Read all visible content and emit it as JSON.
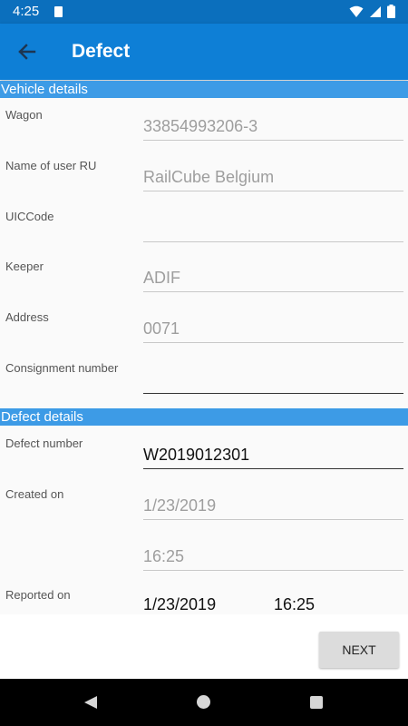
{
  "status": {
    "time": "4:25"
  },
  "appbar": {
    "title": "Defect"
  },
  "vehicle": {
    "header": "Vehicle details",
    "wagon": {
      "label": "Wagon",
      "value": "33854993206-3"
    },
    "user_ru": {
      "label": "Name of user RU",
      "value": "RailCube Belgium"
    },
    "uic": {
      "label": "UICCode",
      "value": ""
    },
    "keeper": {
      "label": "Keeper",
      "value": "ADIF"
    },
    "address": {
      "label": "Address",
      "value": "0071"
    },
    "consignment": {
      "label": "Consignment number",
      "value": ""
    }
  },
  "defect": {
    "header": "Defect details",
    "number": {
      "label": "Defect number",
      "value": "W2019012301"
    },
    "created": {
      "label": "Created on",
      "date": "1/23/2019",
      "time": "16:25"
    },
    "reported": {
      "label": "Reported on",
      "date": "1/23/2019",
      "time": "16:25"
    }
  },
  "actions": {
    "next": "NEXT"
  }
}
